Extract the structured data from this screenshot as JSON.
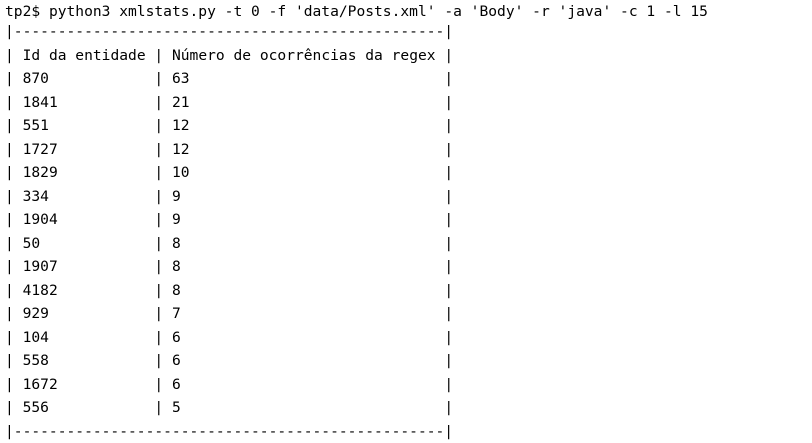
{
  "terminal": {
    "prompt": "tp2$ ",
    "command": "python3 xmlstats.py -t 0 -f 'data/Posts.xml' -a 'Body' -r 'java' -c 1 -l 15"
  },
  "table": {
    "headers": [
      "Id da entidade",
      "Número de ocorrências da regex"
    ],
    "rows": [
      [
        "870",
        "63"
      ],
      [
        "1841",
        "21"
      ],
      [
        "551",
        "12"
      ],
      [
        "1727",
        "12"
      ],
      [
        "1829",
        "10"
      ],
      [
        "334",
        "9"
      ],
      [
        "1904",
        "9"
      ],
      [
        "50",
        "8"
      ],
      [
        "1907",
        "8"
      ],
      [
        "4182",
        "8"
      ],
      [
        "929",
        "7"
      ],
      [
        "104",
        "6"
      ],
      [
        "558",
        "6"
      ],
      [
        "1672",
        "6"
      ],
      [
        "556",
        "5"
      ]
    ]
  }
}
